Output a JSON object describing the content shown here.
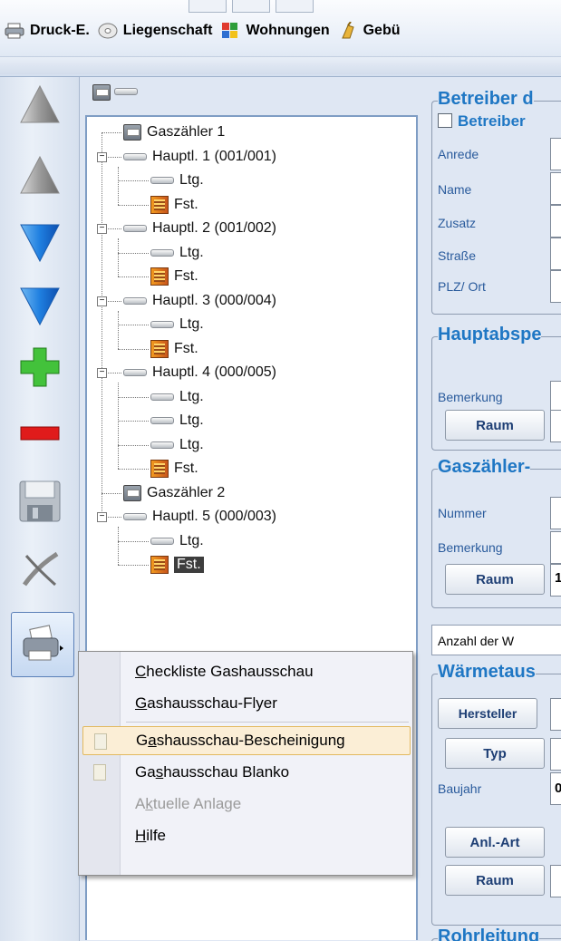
{
  "toolbar": {
    "tabs": [
      {
        "label": "Druck-E.",
        "icon": "printer-icon"
      },
      {
        "label": "Liegenschaft",
        "icon": "disc-icon"
      },
      {
        "label": "Wohnungen",
        "icon": "grid-icon"
      },
      {
        "label": "Gebü",
        "icon": "broom-icon"
      }
    ]
  },
  "left_tools": [
    {
      "name": "move-top-icon",
      "glyph": "up"
    },
    {
      "name": "move-up-icon",
      "glyph": "up"
    },
    {
      "name": "move-down-icon",
      "glyph": "down"
    },
    {
      "name": "move-bottom-icon",
      "glyph": "down"
    },
    {
      "name": "add-icon",
      "glyph": "plus"
    },
    {
      "name": "remove-icon",
      "glyph": "minus"
    },
    {
      "name": "save-icon",
      "glyph": "disk"
    },
    {
      "name": "cancel-icon",
      "glyph": "x"
    },
    {
      "name": "print-icon",
      "glyph": "print"
    }
  ],
  "tree": {
    "nodes": [
      {
        "label": "Gaszähler 1",
        "type": "gas",
        "level": 1,
        "expander": false
      },
      {
        "label": "Hauptl. 1 (001/001)",
        "type": "pipe",
        "level": 1,
        "expander": true
      },
      {
        "label": "Ltg.",
        "type": "pipe",
        "level": 2,
        "expander": false
      },
      {
        "label": "Fst.",
        "type": "fst",
        "level": 2,
        "expander": false
      },
      {
        "label": "Hauptl. 2 (001/002)",
        "type": "pipe",
        "level": 1,
        "expander": true
      },
      {
        "label": "Ltg.",
        "type": "pipe",
        "level": 2,
        "expander": false
      },
      {
        "label": "Fst.",
        "type": "fst",
        "level": 2,
        "expander": false
      },
      {
        "label": "Hauptl. 3 (000/004)",
        "type": "pipe",
        "level": 1,
        "expander": true
      },
      {
        "label": "Ltg.",
        "type": "pipe",
        "level": 2,
        "expander": false
      },
      {
        "label": "Fst.",
        "type": "fst",
        "level": 2,
        "expander": false
      },
      {
        "label": "Hauptl. 4 (000/005)",
        "type": "pipe",
        "level": 1,
        "expander": true
      },
      {
        "label": "Ltg.",
        "type": "pipe",
        "level": 2,
        "expander": false
      },
      {
        "label": "Ltg.",
        "type": "pipe",
        "level": 2,
        "expander": false
      },
      {
        "label": "Ltg.",
        "type": "pipe",
        "level": 2,
        "expander": false
      },
      {
        "label": "Fst.",
        "type": "fst",
        "level": 2,
        "expander": false
      },
      {
        "label": "Gaszähler 2",
        "type": "gas",
        "level": 1,
        "expander": false
      },
      {
        "label": "Hauptl. 5 (000/003)",
        "type": "pipe",
        "level": 1,
        "expander": true
      },
      {
        "label": "Ltg.",
        "type": "pipe",
        "level": 2,
        "expander": false
      },
      {
        "label": "Fst.",
        "type": "fst",
        "level": 2,
        "expander": false,
        "selected": true
      }
    ]
  },
  "form": {
    "betreiber": {
      "title": "Betreiber d",
      "checkbox_label": "Betreiber",
      "fields": [
        "Anrede",
        "Name",
        "Zusatz",
        "Straße",
        "PLZ/ Ort"
      ]
    },
    "hauptabsp": {
      "title": "Hauptabspe",
      "bemerkung_label": "Bemerkung",
      "raum_button": "Raum"
    },
    "gaszaehler": {
      "title": "Gaszähler-",
      "nummer_label": "Nummer",
      "bemerkung_label": "Bemerkung",
      "raum_button": "Raum",
      "raum_value": "1"
    },
    "anzahl_label": "Anzahl der W",
    "waermetaus": {
      "title": "Wärmetaus",
      "hersteller_button": "Hersteller",
      "typ_button": "Typ",
      "baujahr_label": "Baujahr",
      "baujahr_value": "0",
      "anlart_button": "Anl.-Art",
      "raum_button": "Raum"
    },
    "rohrleitung": {
      "title": "Rohrleitung"
    }
  },
  "context_menu": {
    "items": [
      {
        "label": "Checkliste Gashausschau",
        "accel_index": 0,
        "state": "normal",
        "icon": false
      },
      {
        "label": "Gashausschau-Flyer",
        "accel_index": 0,
        "state": "normal",
        "icon": false,
        "separator_after": true
      },
      {
        "label": "Gashausschau-Bescheinigung",
        "accel_index": 1,
        "state": "highlighted",
        "icon": true
      },
      {
        "label": "Gashausschau Blanko",
        "accel_index": 2,
        "state": "normal",
        "icon": true
      },
      {
        "label": "Aktuelle Anlage",
        "accel_index": 1,
        "state": "disabled",
        "icon": false
      },
      {
        "label": "Hilfe",
        "accel_index": 0,
        "state": "normal",
        "icon": false
      }
    ]
  }
}
